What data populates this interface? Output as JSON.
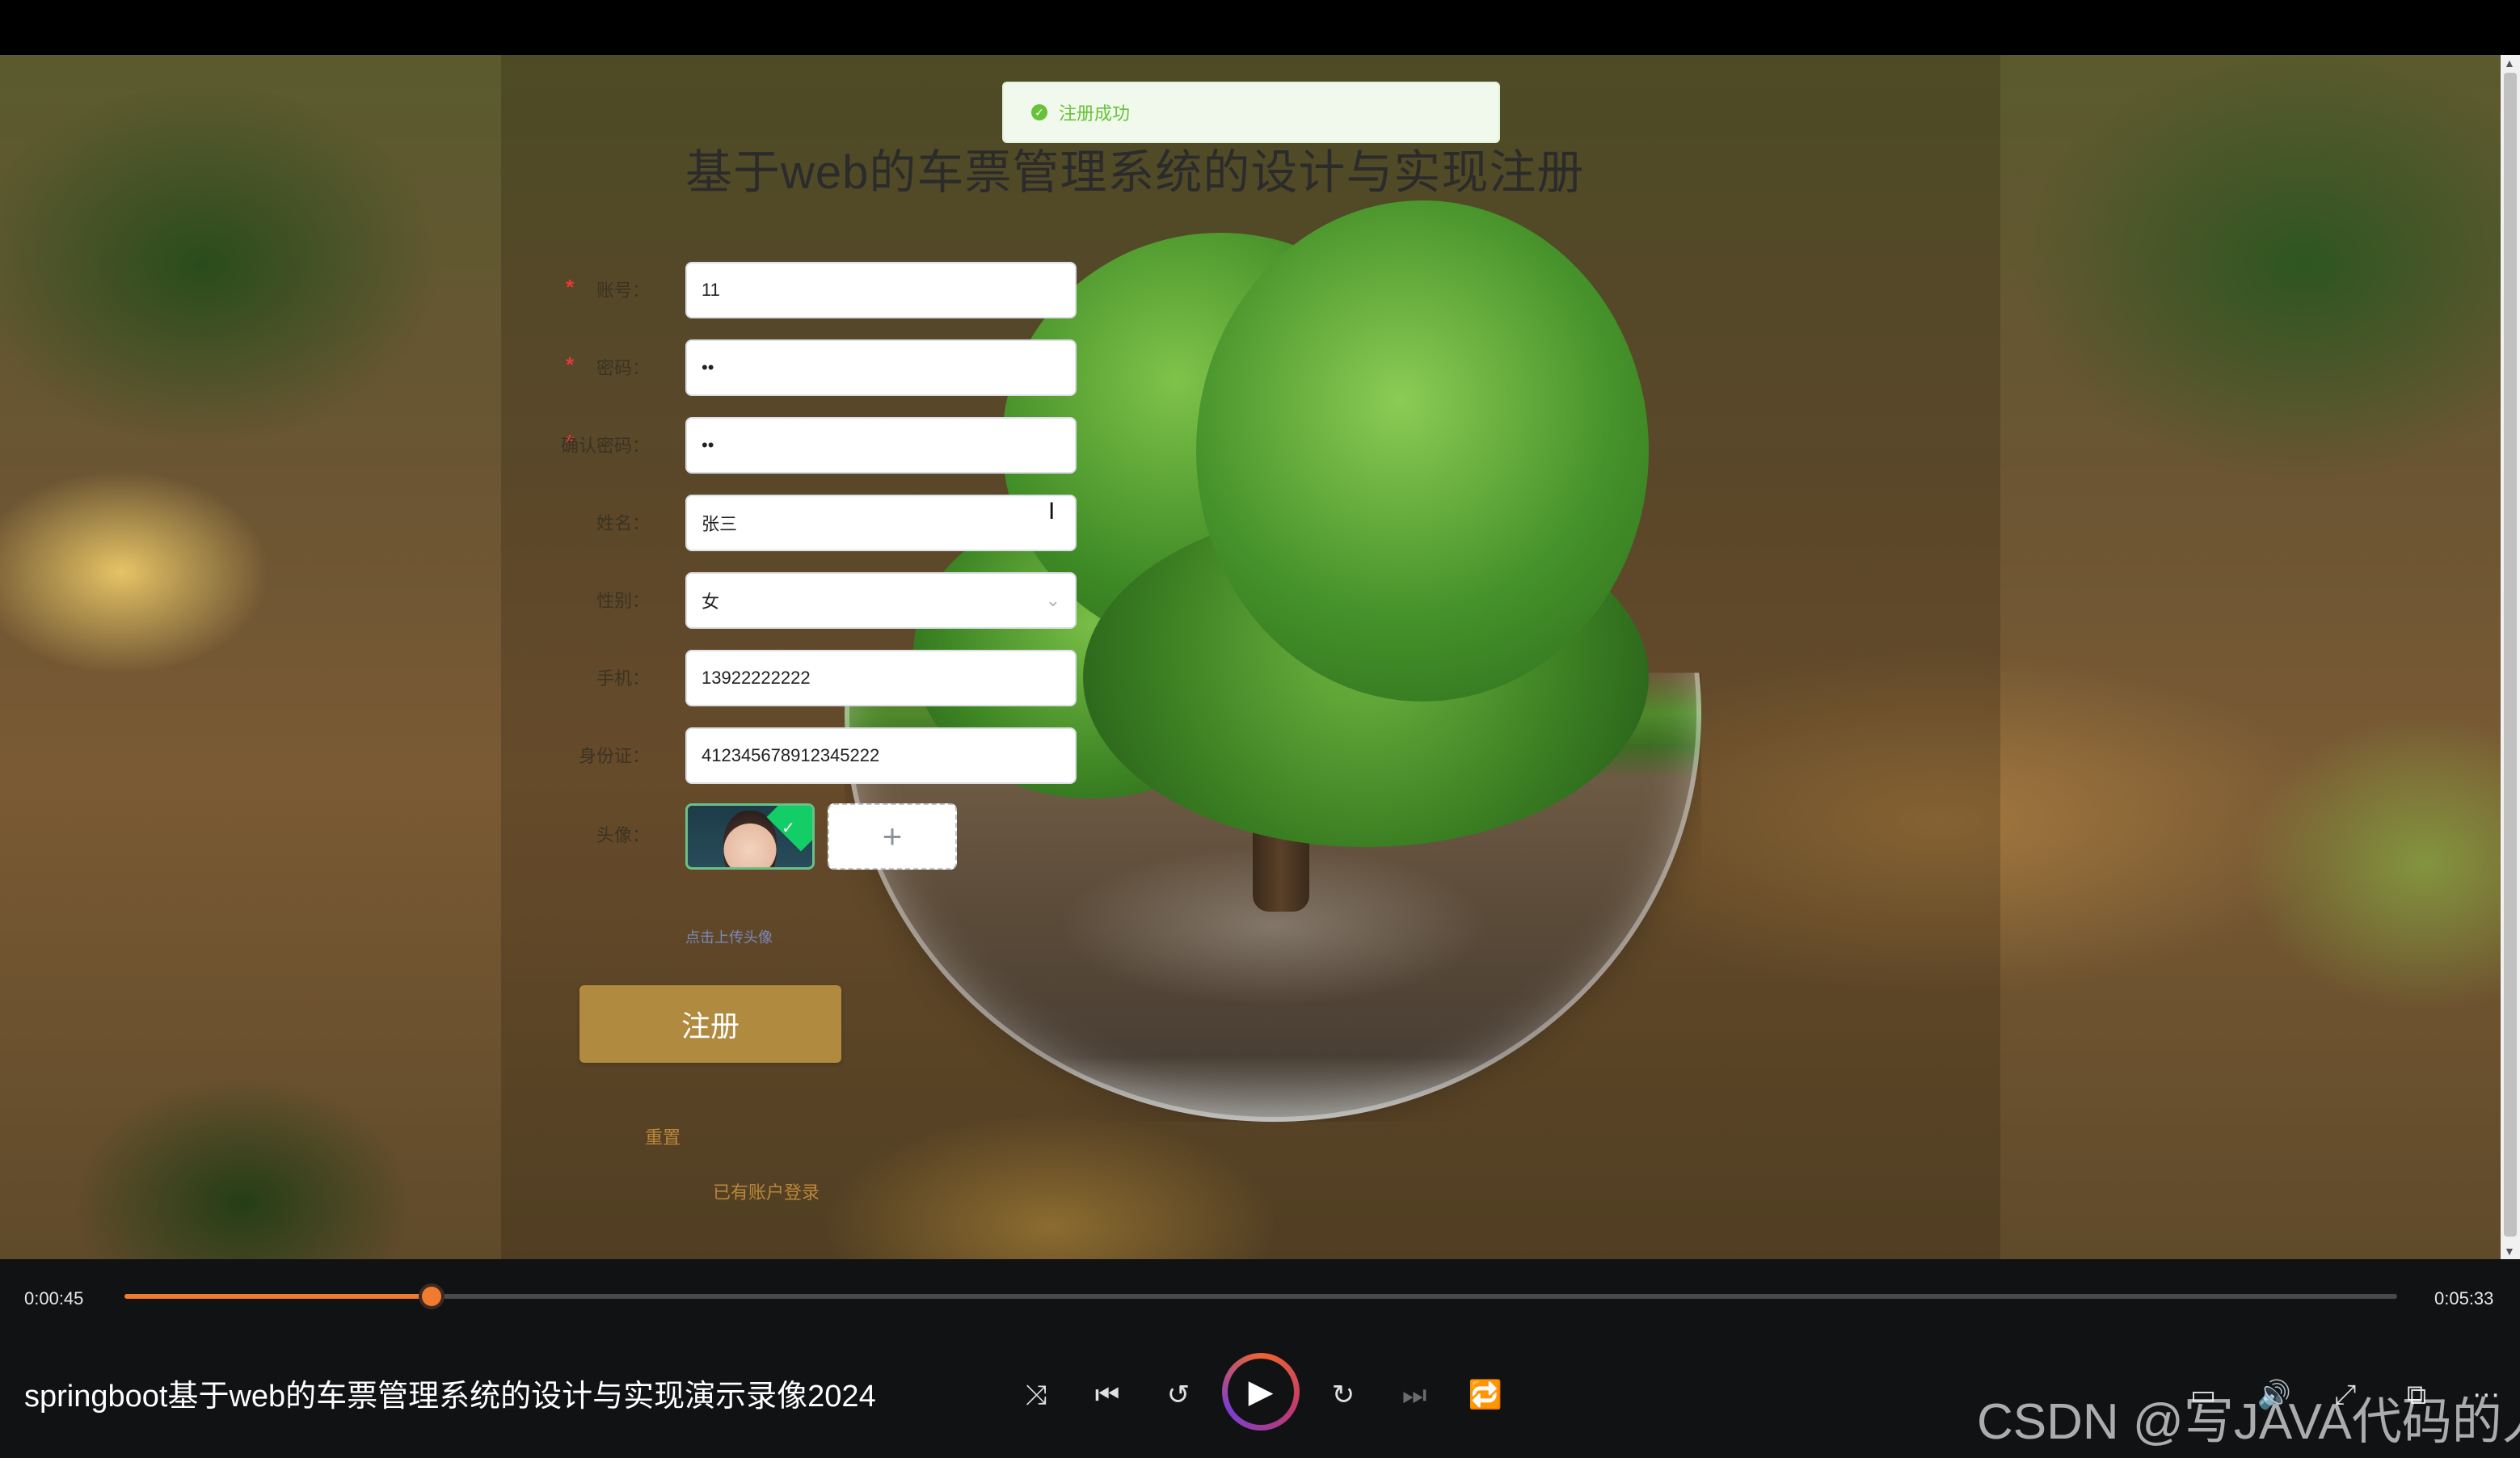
{
  "toast": {
    "message": "注册成功"
  },
  "page": {
    "title": "基于web的车票管理系统的设计与实现注册"
  },
  "form": {
    "account": {
      "label": "账号：",
      "value": "11",
      "required": true
    },
    "password": {
      "label": "密码：",
      "value": "••",
      "required": true
    },
    "confirm_password": {
      "label": "确认密码：",
      "value": "••",
      "required": true
    },
    "name": {
      "label": "姓名：",
      "value": "张三"
    },
    "gender": {
      "label": "性别：",
      "value": "女"
    },
    "phone": {
      "label": "手机：",
      "value": "13922222222"
    },
    "id_card": {
      "label": "身份证：",
      "value": "412345678912345222"
    },
    "avatar": {
      "label": "头像：",
      "upload_tip": "点击上传头像",
      "add_symbol": "+"
    },
    "register_label": "注册",
    "reset_label": "重置",
    "login_link": "已有账户登录"
  },
  "player": {
    "current_time": "0:00:45",
    "duration": "0:05:33",
    "progress": 0.135,
    "title": "springboot基于web的车票管理系统的设计与实现演示录像2024",
    "accent_color": "#f07a2e"
  },
  "watermark": "CSDN @写JAVA代码的人"
}
